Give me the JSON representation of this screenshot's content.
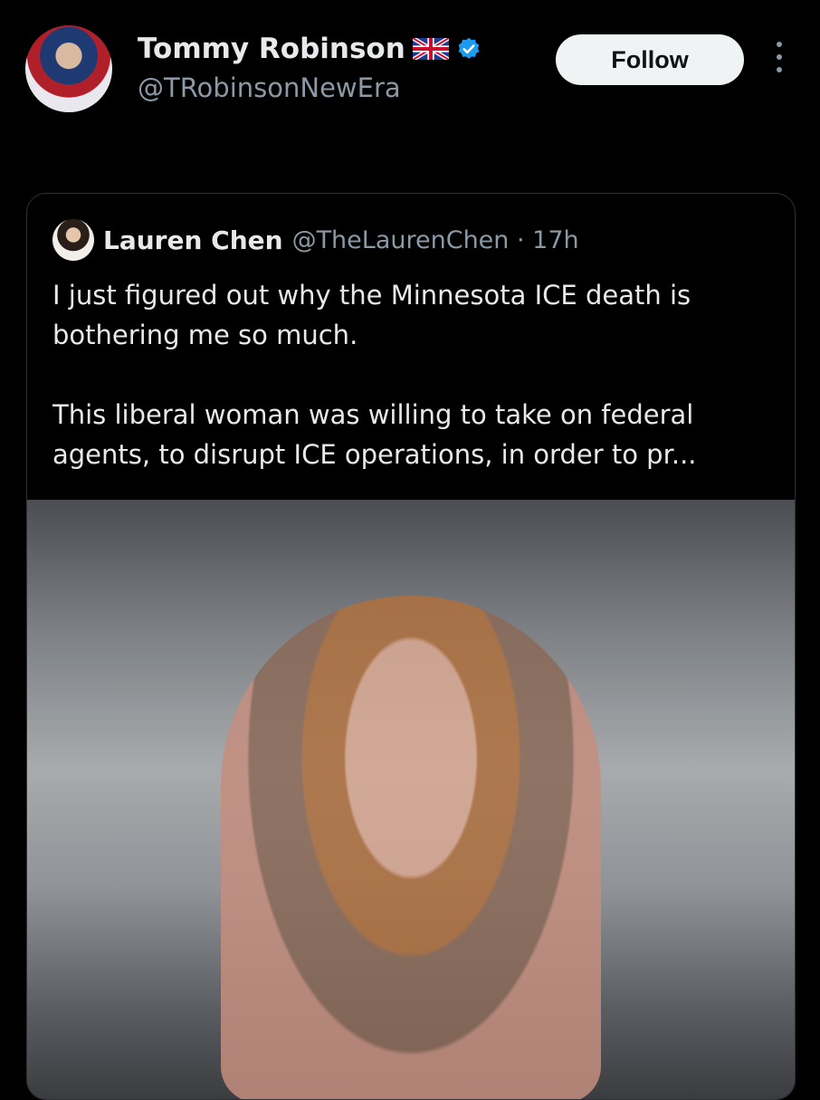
{
  "author": {
    "display_name": "Tommy Robinson",
    "handle": "@TRobinsonNewEra",
    "flag_icon": "uk-flag-icon",
    "verified_icon": "verified-badge-icon"
  },
  "follow_label": "Follow",
  "quoted": {
    "display_name": "Lauren Chen",
    "handle_time": "@TheLaurenChen · 17h",
    "text_p1": "I just figured out why the Minnesota ICE death is bothering me so much.",
    "text_p2": "This liberal woman was willing to take on federal agents, to disrupt ICE operations, in order to pr..."
  },
  "colors": {
    "background": "#000000",
    "text": "#e7e9ea",
    "secondary": "#8b98a5",
    "verified": "#1d9bf0",
    "follow_bg": "#eff3f4"
  }
}
